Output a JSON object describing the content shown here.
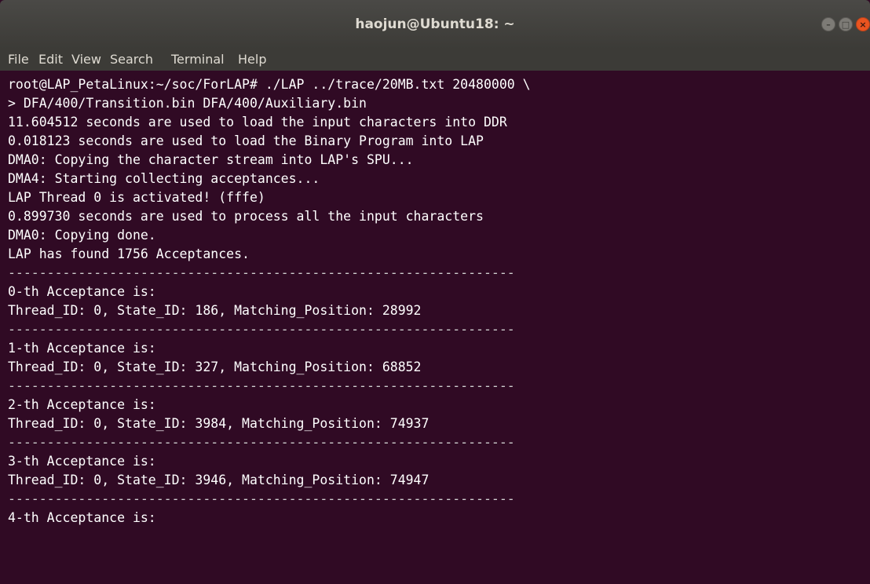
{
  "window": {
    "title": "haojun@Ubuntu18: ~",
    "buttons": {
      "minimize": "–",
      "maximize": "□",
      "close": "×"
    }
  },
  "menubar": {
    "items": [
      "File",
      "Edit",
      "View",
      "Search",
      "Terminal",
      "Help"
    ]
  },
  "terminal": {
    "lines": [
      "root@LAP_PetaLinux:~/soc/ForLAP# ./LAP ../trace/20MB.txt 20480000 \\",
      "> DFA/400/Transition.bin DFA/400/Auxiliary.bin",
      "11.604512 seconds are used to load the input characters into DDR",
      "0.018123 seconds are used to load the Binary Program into LAP",
      "DMA0: Copying the character stream into LAP's SPU...",
      "DMA4: Starting collecting acceptances...",
      "LAP Thread 0 is activated! (fffe)",
      "0.899730 seconds are used to process all the input characters",
      "DMA0: Copying done.",
      "LAP has found 1756 Acceptances.",
      "-----------------------------------------------------------------",
      "0-th Acceptance is:",
      "Thread_ID: 0, State_ID: 186, Matching_Position: 28992",
      "-----------------------------------------------------------------",
      "1-th Acceptance is:",
      "Thread_ID: 0, State_ID: 327, Matching_Position: 68852",
      "-----------------------------------------------------------------",
      "2-th Acceptance is:",
      "Thread_ID: 0, State_ID: 3984, Matching_Position: 74937",
      "-----------------------------------------------------------------",
      "3-th Acceptance is:",
      "Thread_ID: 0, State_ID: 3946, Matching_Position: 74947",
      "-----------------------------------------------------------------",
      "4-th Acceptance is:"
    ]
  },
  "colors": {
    "terminal_bg": "#300a24",
    "titlebar_bg": "#3c3b37",
    "close_button": "#e95420"
  }
}
